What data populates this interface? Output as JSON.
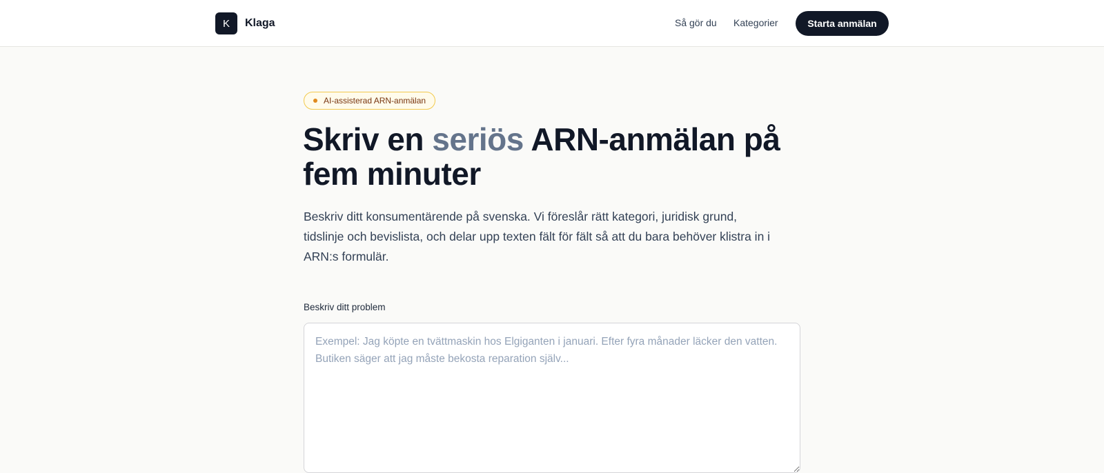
{
  "header": {
    "logo_letter": "K",
    "brand": "Klaga",
    "nav": [
      {
        "label": "Så gör du"
      },
      {
        "label": "Kategorier"
      }
    ],
    "cta_label": "Starta anmälan"
  },
  "hero": {
    "badge": "AI-assisterad ARN-anmälan",
    "title_part1": "Skriv en ",
    "title_accent": "seriös",
    "title_part2": " ARN-anmälan på fem minuter",
    "lead": "Beskriv ditt konsumentärende på svenska. Vi föreslår rätt kategori, juridisk grund, tidslinje och bevislista, och delar upp texten fält för fält så att du bara behöver klistra in i ARN:s formulär."
  },
  "form": {
    "problem_label": "Beskriv ditt problem",
    "problem_value": "",
    "problem_placeholder": "Exempel: Jag köpte en tvättmaskin hos Elgiganten i januari. Efter fyra månader läcker den vatten. Butiken säger att jag måste bekosta reparation själv..."
  },
  "colors": {
    "background": "#fafaf8",
    "primary": "#111827",
    "accent_text": "#64748b",
    "badge_border": "#f2c94c",
    "badge_dot": "#e08a1e"
  }
}
